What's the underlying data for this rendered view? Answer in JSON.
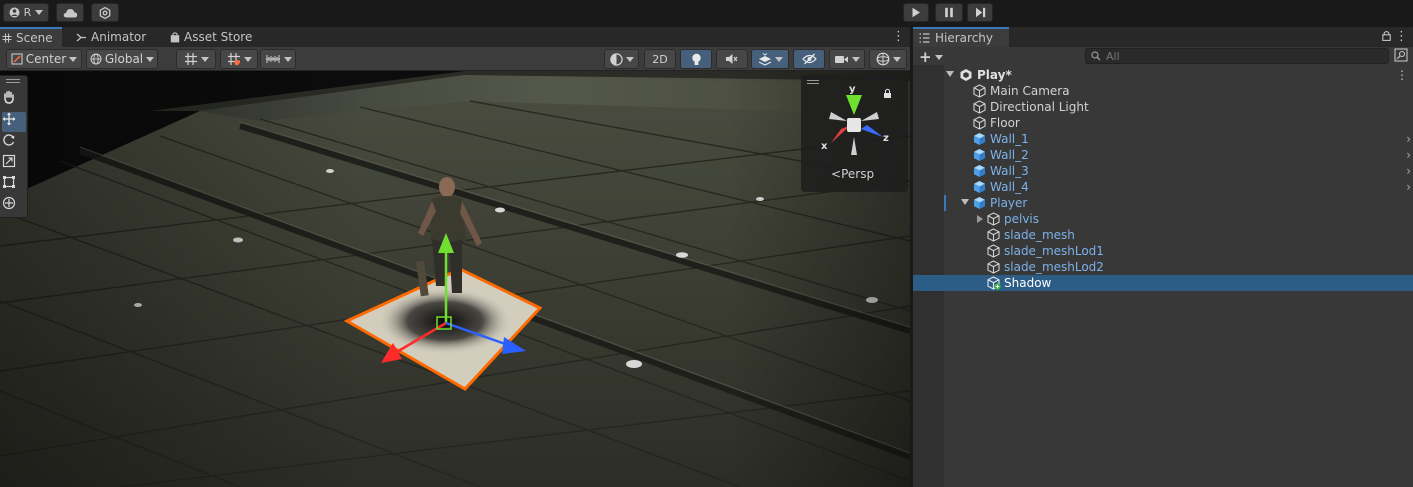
{
  "toolbar": {
    "account_label": "R",
    "play_icon": "play-icon",
    "pause_icon": "pause-icon",
    "step_icon": "step-icon"
  },
  "scene_panel": {
    "tabs": [
      {
        "label": "Scene",
        "active": true
      },
      {
        "label": "Animator",
        "active": false
      },
      {
        "label": "Asset Store",
        "active": false
      }
    ],
    "pivot_mode": "Center",
    "pivot_rotation": "Global",
    "mode_2d": "2D",
    "camera_mode": "Persp",
    "transform_tools": [
      "hand-tool",
      "move-tool",
      "rotate-tool",
      "scale-tool",
      "rect-tool",
      "transform-tool"
    ],
    "active_tool": "move-tool"
  },
  "hierarchy": {
    "tab_label": "Hierarchy",
    "add_label": "+",
    "search_placeholder": "All",
    "scene_name": "Play*",
    "items": [
      {
        "name": "Main Camera",
        "prefab": false
      },
      {
        "name": "Directional Light",
        "prefab": false
      },
      {
        "name": "Floor",
        "prefab": false
      },
      {
        "name": "Wall_1",
        "prefab": true
      },
      {
        "name": "Wall_2",
        "prefab": true
      },
      {
        "name": "Wall_3",
        "prefab": true
      },
      {
        "name": "Wall_4",
        "prefab": true
      },
      {
        "name": "Player",
        "prefab": true,
        "expanded": true
      },
      {
        "name": "pelvis",
        "prefab": true,
        "child": true,
        "collapsed": true
      },
      {
        "name": "slade_mesh",
        "prefab": true,
        "child": true
      },
      {
        "name": "slade_meshLod1",
        "prefab": true,
        "child": true
      },
      {
        "name": "slade_meshLod2",
        "prefab": true,
        "child": true
      },
      {
        "name": "Shadow",
        "prefab": false,
        "child": true,
        "selected": true
      }
    ]
  },
  "colors": {
    "accent": "#3a79bb",
    "selection": "#2c5d87",
    "prefab_text": "#7cb2e8",
    "selection_outline": "#ff6a00"
  }
}
